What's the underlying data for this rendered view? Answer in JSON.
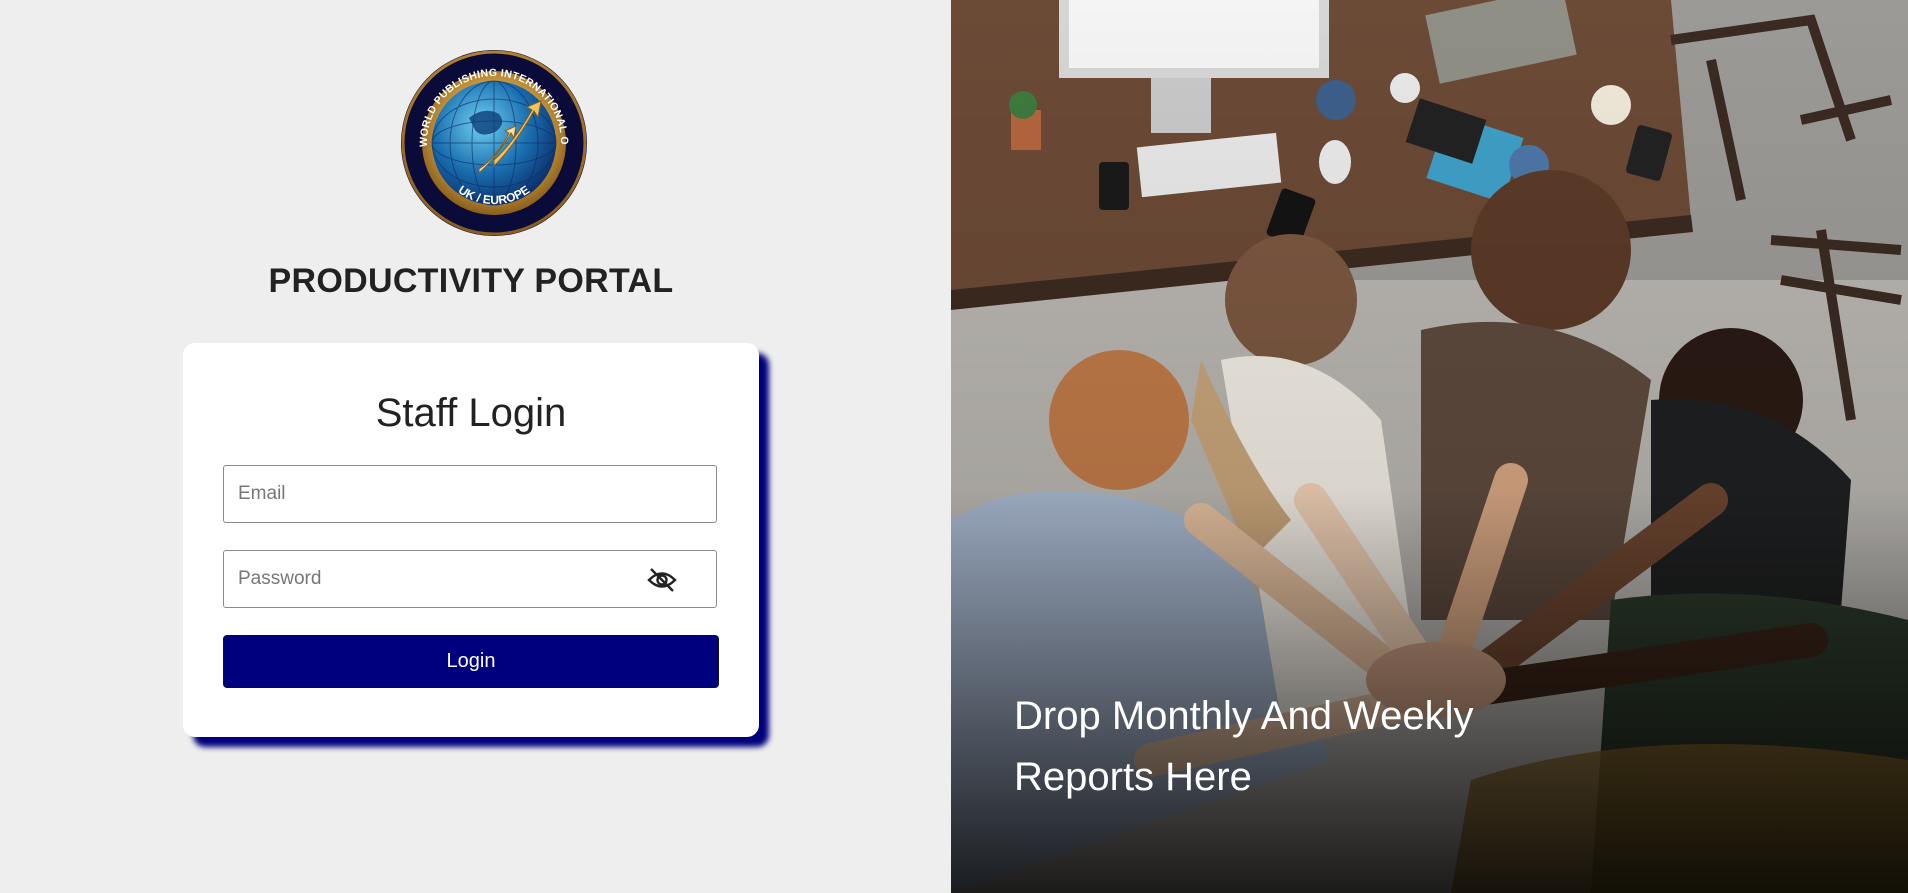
{
  "logo": {
    "arc_text": "LOVEWORLD PUBLISHING INTERNATIONAL OFFICE",
    "bottom_text": "UK / EUROPE"
  },
  "header": {
    "title": "PRODUCTIVITY PORTAL"
  },
  "login_card": {
    "title": "Staff Login",
    "email_placeholder": "Email",
    "password_placeholder": "Password",
    "toggle_icon": "eye-slash-icon",
    "login_label": "Login"
  },
  "hero": {
    "caption": "Drop Monthly And Weekly Reports Here"
  },
  "colors": {
    "primary": "#00007e",
    "background": "#eeeeee",
    "card": "#ffffff",
    "gold": "#d9a84a"
  }
}
